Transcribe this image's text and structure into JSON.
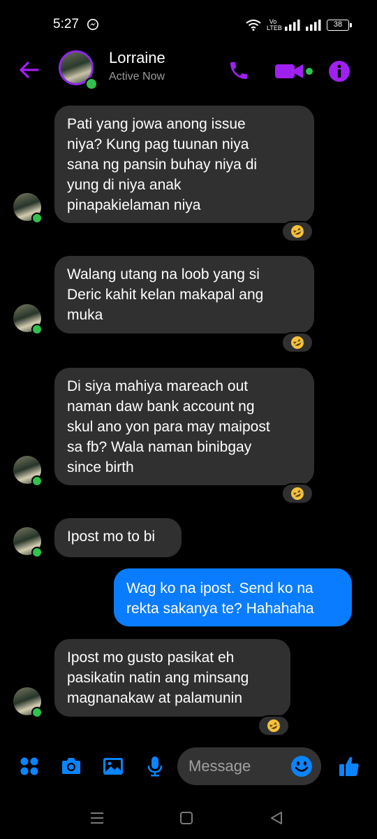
{
  "status_bar": {
    "time": "5:27",
    "volte_top": "Vo",
    "volte_bottom": "LTEB",
    "battery": "38"
  },
  "header": {
    "contact_name": "Lorraine",
    "contact_status": "Active Now"
  },
  "messages": [
    {
      "direction": "incoming",
      "lines": [
        "Pati yang jowa anong issue",
        "niya? Kung pag tuunan niya",
        "sana ng pansin buhay niya di",
        "yung di niya anak",
        "pinapakielaman niya"
      ],
      "reaction": "rolling-on-floor-laughing-emoji"
    },
    {
      "direction": "incoming",
      "lines": [
        "Walang utang na loob yang si",
        "Deric kahit kelan makapal ang",
        "muka"
      ],
      "reaction": "rolling-on-floor-laughing-emoji"
    },
    {
      "direction": "incoming",
      "lines": [
        "Di siya mahiya mareach out",
        "naman daw bank account ng",
        "skul ano yon para may maipost",
        "sa fb? Wala naman binibgay",
        "since birth"
      ],
      "reaction": "rolling-on-floor-laughing-emoji"
    },
    {
      "direction": "incoming",
      "lines": [
        "Ipost mo to bi"
      ],
      "reaction": null
    },
    {
      "direction": "outgoing",
      "lines": [
        "Wag ko na ipost. Send ko na",
        "rekta sakanya te? Hahahaha"
      ],
      "reaction": null
    },
    {
      "direction": "incoming",
      "lines": [
        "Ipost mo gusto pasikat eh",
        "pasikatin natin ang minsang",
        "magnanakaw at palamunin"
      ],
      "reaction": "rolling-on-floor-laughing-emoji"
    }
  ],
  "composer": {
    "placeholder": "Message"
  },
  "colors": {
    "accent_purple": "#a020f0",
    "composer_blue": "#0a84ff",
    "outgoing_bubble": "#0a7cff",
    "incoming_bubble": "#303030",
    "online_green": "#31c24d"
  },
  "icons": {
    "back": "arrow-left-icon",
    "call": "phone-icon",
    "video": "video-camera-icon",
    "info": "info-icon",
    "apps": "four-dots-icon",
    "camera": "camera-icon",
    "gallery": "image-icon",
    "mic": "microphone-icon",
    "emoji": "smiley-icon",
    "like": "thumbs-up-icon"
  }
}
